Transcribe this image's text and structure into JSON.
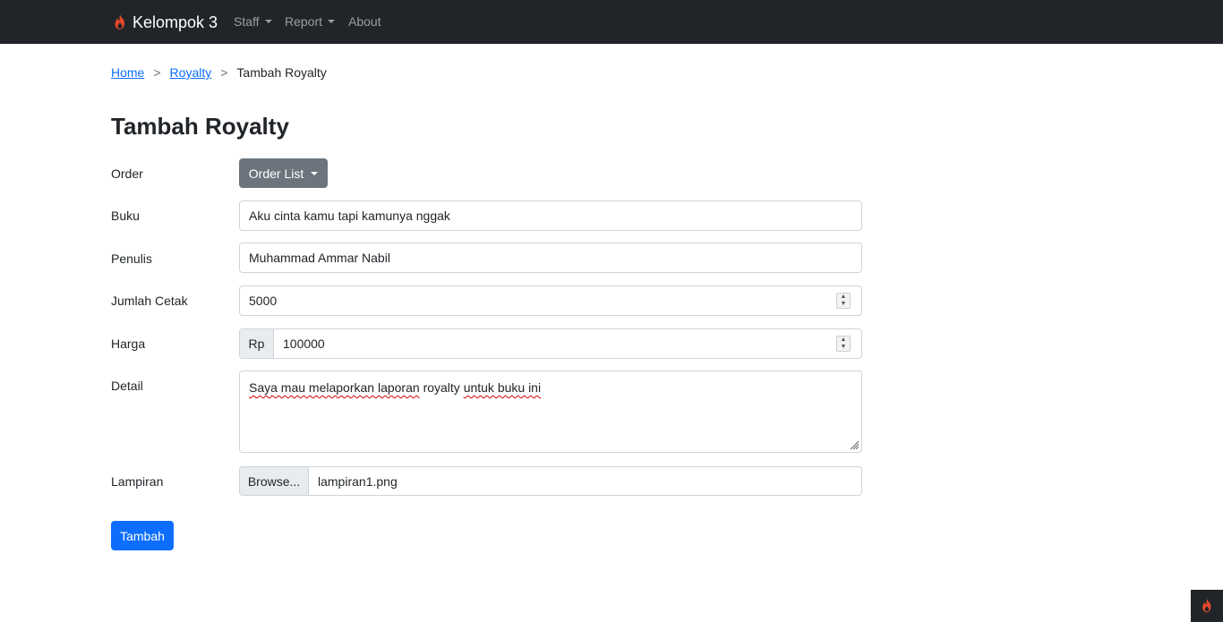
{
  "navbar": {
    "brand": "Kelompok 3",
    "brand_icon": "flame-icon",
    "items": [
      {
        "label": "Staff",
        "dropdown": true
      },
      {
        "label": "Report",
        "dropdown": true
      },
      {
        "label": "About",
        "dropdown": false
      }
    ]
  },
  "breadcrumb": {
    "items": [
      {
        "label": "Home",
        "link": true
      },
      {
        "label": "Royalty",
        "link": true
      },
      {
        "label": "Tambah Royalty",
        "link": false
      }
    ],
    "separator": ">"
  },
  "page": {
    "title": "Tambah Royalty"
  },
  "form": {
    "order": {
      "label": "Order",
      "button": "Order List"
    },
    "buku": {
      "label": "Buku",
      "value": "Aku cinta kamu tapi kamunya nggak"
    },
    "penulis": {
      "label": "Penulis",
      "value": "Muhammad Ammar Nabil"
    },
    "jumlah_cetak": {
      "label": "Jumlah Cetak",
      "value": "5000"
    },
    "harga": {
      "label": "Harga",
      "prefix": "Rp",
      "value": "100000"
    },
    "detail": {
      "label": "Detail",
      "value_misspelled": "Saya mau melaporkan laporan",
      "value_ok": "royalty",
      "value_misspelled2": "untuk buku ini"
    },
    "lampiran": {
      "label": "Lampiran",
      "browse": "Browse...",
      "filename": "lampiran1.png"
    },
    "submit": "Tambah"
  },
  "colors": {
    "navbar_bg": "#212529",
    "primary": "#0d6efd",
    "secondary": "#6c757d",
    "flame": "#e5482b"
  }
}
